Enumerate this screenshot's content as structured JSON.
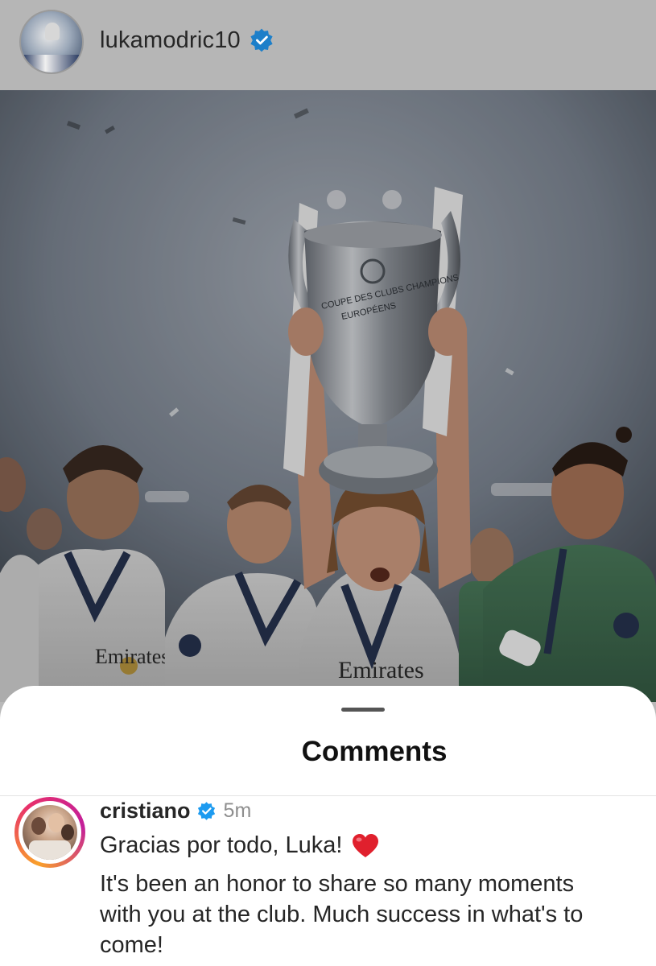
{
  "header": {
    "username": "lukamodric10",
    "verified": true,
    "avatar_icon": "profile-avatar"
  },
  "post": {
    "image_icon": "post-photo",
    "jersey_text": "Emirates",
    "trophy_text_1": "COUPE DES CLUBS CHAMPIONS",
    "trophy_text_2": "EUROPÉENS"
  },
  "comments_sheet": {
    "title": "Comments",
    "comments": [
      {
        "username": "cristiano",
        "verified": true,
        "time": "5m",
        "line1": "Gracias por todo, Luka!",
        "emoji": "red-heart",
        "body": "It's been an honor to share so many moments with you at the club. Much success in what's to come!"
      }
    ]
  },
  "colors": {
    "verified_blue": "#1d9bf0",
    "heart_red": "#e0202d",
    "story_ring_start": "#f9a02a",
    "story_ring_end": "#c31f9a"
  }
}
